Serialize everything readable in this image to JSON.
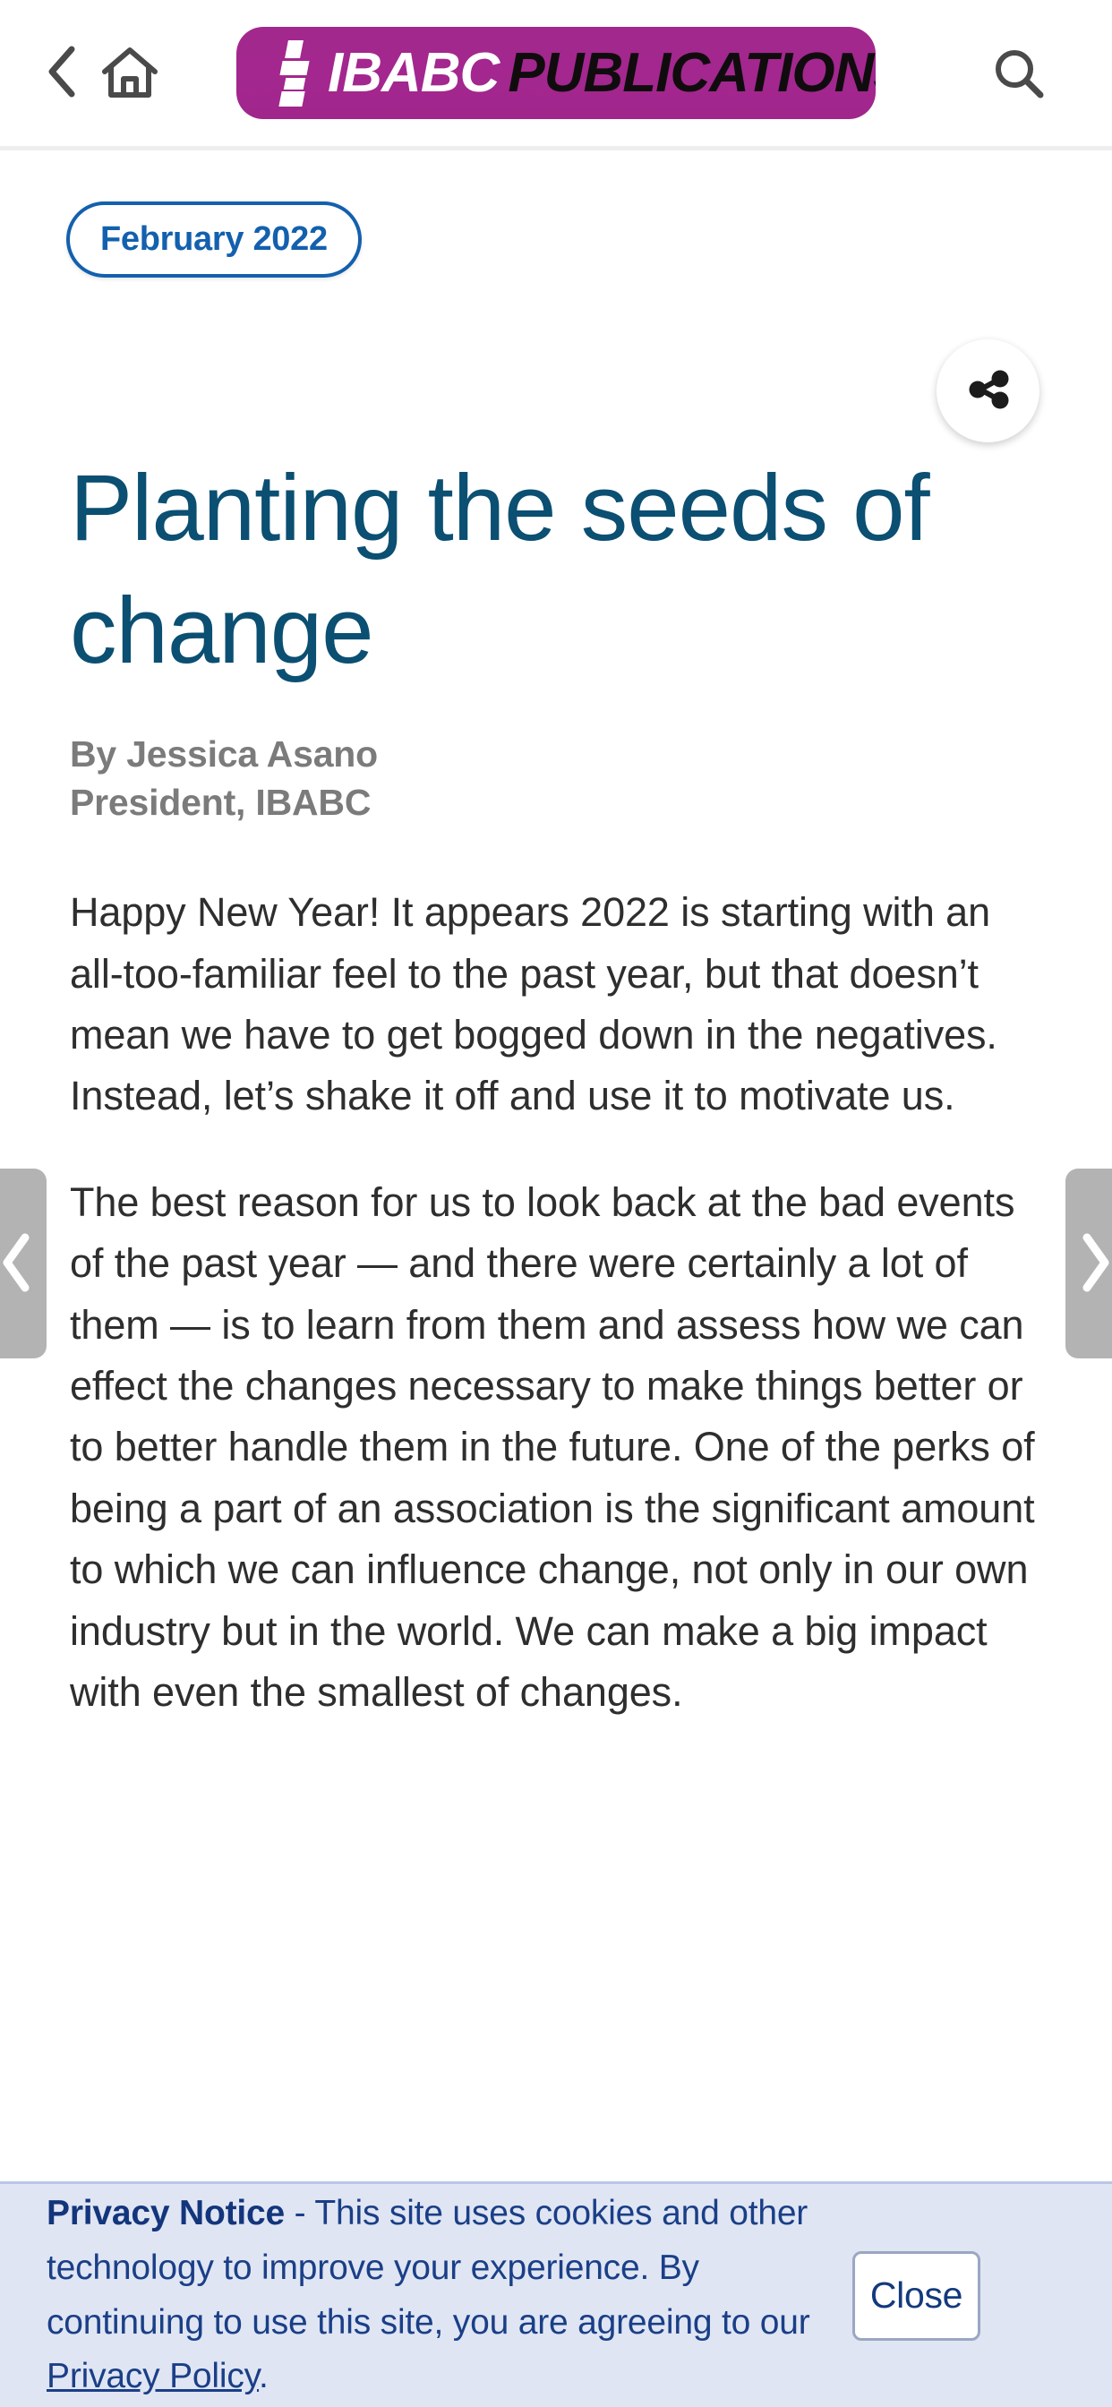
{
  "header": {
    "back_label": "Back",
    "home_label": "Home",
    "search_label": "Search",
    "logo": {
      "word1": "IBABC",
      "word2": "PUBLICATIONS",
      "background_color": "#A3288D"
    }
  },
  "issue": {
    "badge_label": "February 2022",
    "badge_color": "#1360AE"
  },
  "share": {
    "label": "Share"
  },
  "article": {
    "title": "Planting the seeds of change",
    "title_color": "#0B4F72",
    "author": "By Jessica Asano",
    "author_role": "President, IBABC",
    "paragraphs": [
      "Happy New Year! It appears 2022 is starting with an all-too-familiar feel to the past year, but that doesn’t mean we have to get bogged down in the negatives. Instead, let’s shake it off and use it to motivate us.",
      "The best reason for us to look back at the bad events of the past year — and there were certainly a lot of them — is to learn from them and assess how we can effect the changes necessary to make things better or to better handle them in the future. One of the perks of being a part of an association is the significant amount to which we can influence change, not only in our own industry but in the world. We can make a big impact with even the smallest of changes."
    ]
  },
  "pager": {
    "prev_label": "Previous article",
    "next_label": "Next article"
  },
  "privacy": {
    "heading": "Privacy Notice",
    "separator": " - ",
    "body": "This site uses cookies and other technology to improve your experience. By continuing to use this site, you are agreeing to our ",
    "link_text": "Privacy Policy",
    "trailing": ".",
    "close_label": "Close",
    "background_color": "#E0E5F3",
    "text_color": "#1A3F87"
  }
}
